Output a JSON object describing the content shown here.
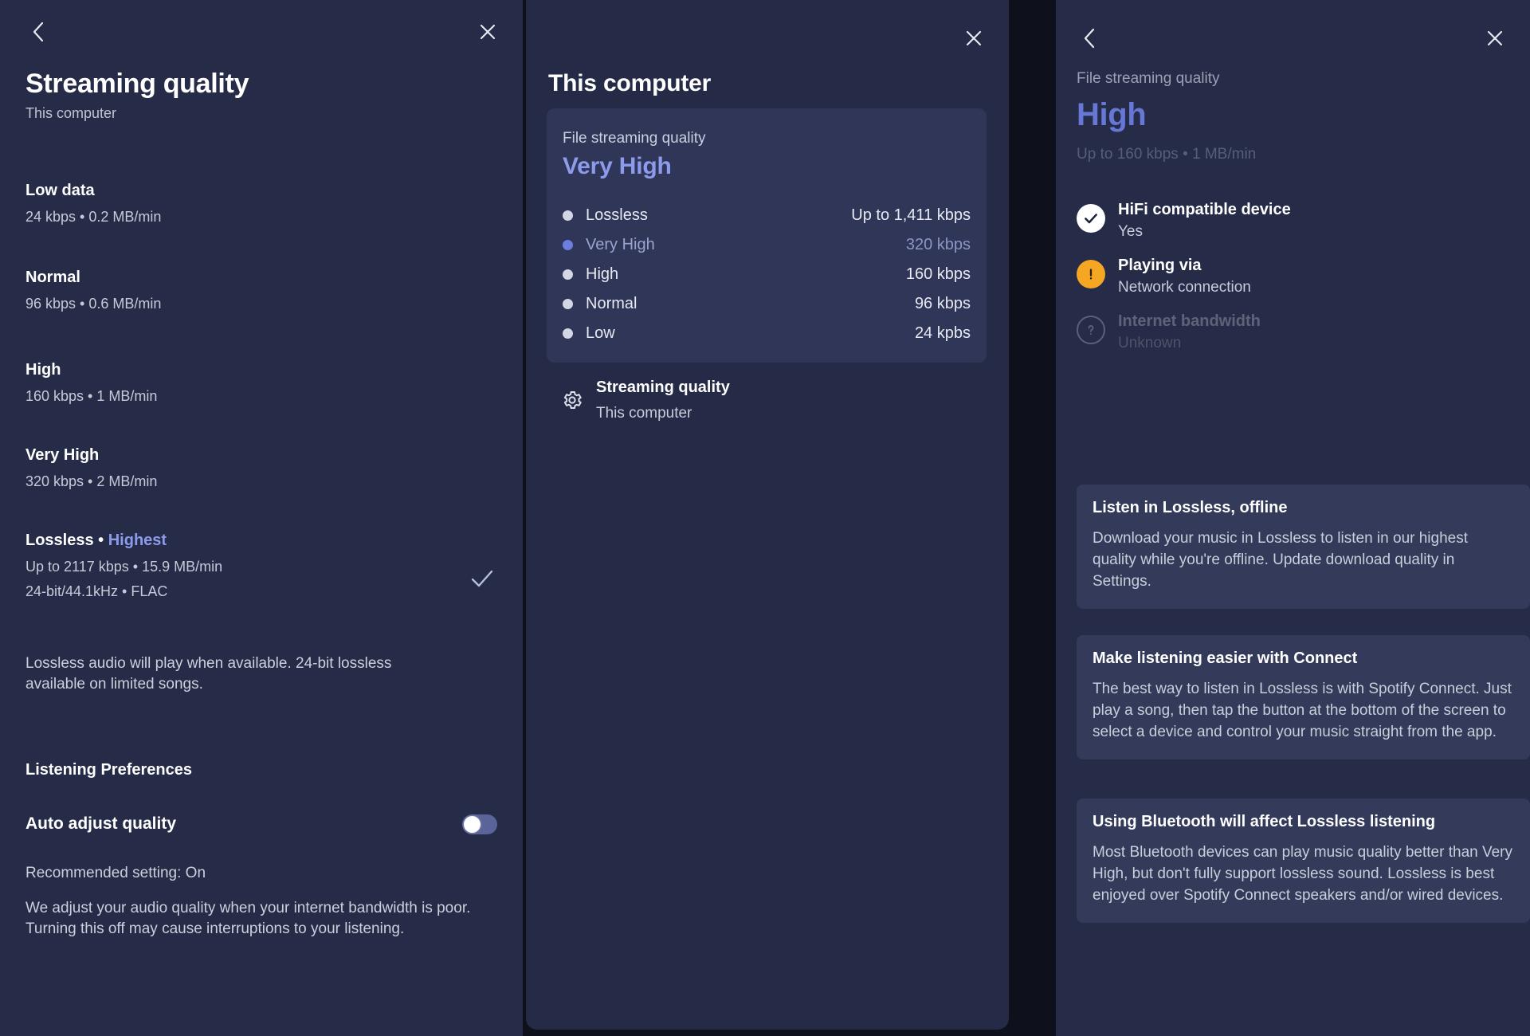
{
  "panel_left": {
    "back_icon": "chevron-left-icon",
    "close_icon": "close-icon",
    "title": "Streaming quality",
    "subtitle": "This computer",
    "qualities": [
      {
        "name": "Low data",
        "meta": "24 kbps • 0.2 MB/min",
        "selected": false
      },
      {
        "name": "Normal",
        "meta": "96 kbps • 0.6 MB/min",
        "selected": false
      },
      {
        "name": "High",
        "meta": "160 kbps • 1 MB/min",
        "selected": false
      },
      {
        "name": "Very High",
        "meta": "320 kbps • 2 MB/min",
        "selected": false
      },
      {
        "name": "Lossless",
        "badge": "Highest",
        "meta": "Up to 2117 kbps • 15.9 MB/min",
        "meta2": "24-bit/44.1kHz • FLAC",
        "selected": true
      }
    ],
    "note": "Lossless audio will play when available. 24-bit lossless available on limited songs.",
    "section_title": "Listening Preferences",
    "pref_label": "Auto adjust quality",
    "pref_state": "off",
    "recommended": "Recommended setting: On",
    "description": "We adjust your audio quality when your internet bandwidth is poor. Turning this off may cause interruptions to your listening.",
    "accent": "#8d9bec"
  },
  "panel_mid": {
    "close_icon": "close-icon",
    "title": "This computer",
    "card_label": "File streaming quality",
    "card_value": "Very High",
    "options": [
      {
        "name": "Lossless",
        "value": "Up to 1,411 kbps",
        "selected": false
      },
      {
        "name": "Very High",
        "value": "320 kbps",
        "selected": true
      },
      {
        "name": "High",
        "value": "160 kbps",
        "selected": false
      },
      {
        "name": "Normal",
        "value": "96 kbps",
        "selected": false
      },
      {
        "name": "Low",
        "value": "24 kpbs",
        "selected": false
      }
    ],
    "settings_icon": "gear-icon",
    "settings_title": "Streaming quality",
    "settings_sub": "This computer",
    "accent": "#8d9bec"
  },
  "panel_right": {
    "back_icon": "chevron-left-icon",
    "close_icon": "close-icon",
    "kicker": "File streaming quality",
    "value": "High",
    "meta": "Up to 160 kbps • 1 MB/min",
    "statuses": [
      {
        "icon": "check-circle-icon",
        "title": "HiFi compatible device",
        "sub": "Yes",
        "state": "ok"
      },
      {
        "icon": "warning-circle-icon",
        "title": "Playing via",
        "sub": "Network connection",
        "state": "warn"
      },
      {
        "icon": "question-circle-icon",
        "title": "Internet bandwidth",
        "sub": "Unknown",
        "state": "unknown"
      }
    ],
    "cards": [
      {
        "title": "Listen in Lossless, offline",
        "body": "Download your music in Lossless to listen in our highest quality while you're offline. Update download quality in Settings."
      },
      {
        "title": "Make listening easier with Connect",
        "body": "The best way to listen in Lossless is with Spotify Connect. Just play a song, then tap the button at the bottom of the screen to select a device and control your music straight from the app."
      },
      {
        "title": "Using Bluetooth will affect Lossless listening",
        "body": "Most Bluetooth devices can play music quality better than Very High, but don't fully support lossless sound. Lossless is best enjoyed over Spotify Connect speakers and/or wired devices."
      }
    ],
    "accent": "#6677d6",
    "warn_color": "#f5a623"
  }
}
